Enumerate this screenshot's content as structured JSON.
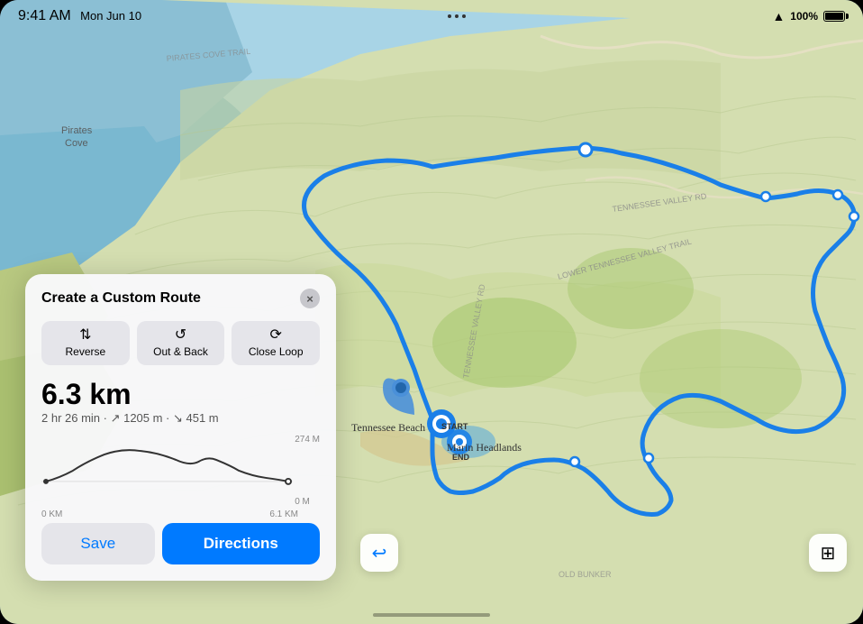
{
  "status_bar": {
    "time": "9:41 AM",
    "date": "Mon Jun 10",
    "battery_percent": "100%",
    "wifi": "wifi"
  },
  "map": {
    "route_color": "#1a7fe8",
    "terrain_colors": {
      "water": "#8bbfd4",
      "land_light": "#dde8c0",
      "land_medium": "#c8d9a0",
      "sand": "#e8ddb5",
      "dark_green": "#b5cc85"
    }
  },
  "card": {
    "title": "Create a Custom Route",
    "close_label": "×",
    "buttons": [
      {
        "icon": "⇅",
        "label": "Reverse"
      },
      {
        "icon": "↺",
        "label": "Out & Back"
      },
      {
        "icon": "⟳",
        "label": "Close Loop"
      }
    ],
    "distance": "6.3 km",
    "stats": "2 hr 26 min · ↗ 1205 m · ↘ 451 m",
    "chart": {
      "elevation_max_label": "274 M",
      "elevation_min_label": "0 M",
      "start_label": "0 KM",
      "end_label": "6.1 KM"
    },
    "save_label": "Save",
    "directions_label": "Directions"
  },
  "locations": {
    "tennessee_beach": "Tennessee Beach",
    "marin_headlands": "Marin Headlands",
    "start_label": "START",
    "end_label": "END"
  },
  "map_buttons": {
    "back_icon": "↩",
    "layers_icon": "⊞"
  }
}
